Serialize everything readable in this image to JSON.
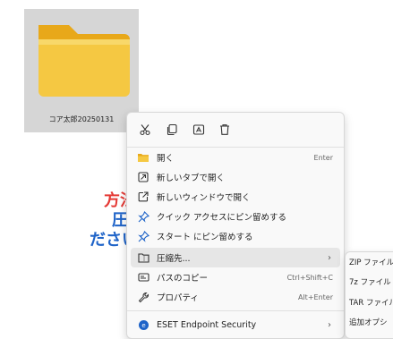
{
  "folder": {
    "name": "コア太郎20250131",
    "icon": "folder-icon"
  },
  "background_text": {
    "line1": "方法",
    "line2": "圧縮",
    "line3": "ださい"
  },
  "context_menu": {
    "top_actions": [
      {
        "icon": "cut-icon"
      },
      {
        "icon": "copy-icon"
      },
      {
        "icon": "rename-icon"
      },
      {
        "icon": "delete-icon"
      }
    ],
    "items": [
      {
        "label": "開く",
        "shortcut": "Enter",
        "icon": "folder-open-icon"
      },
      {
        "label": "新しいタブで開く",
        "shortcut": "",
        "icon": "new-tab-icon"
      },
      {
        "label": "新しいウィンドウで開く",
        "shortcut": "",
        "icon": "new-window-icon"
      },
      {
        "label": "クイック アクセスにピン留めする",
        "shortcut": "",
        "icon": "pin-icon"
      },
      {
        "label": "スタート にピン留めする",
        "shortcut": "",
        "icon": "pin-icon"
      },
      {
        "label": "圧縮先...",
        "shortcut": "",
        "icon": "compress-icon"
      },
      {
        "label": "パスのコピー",
        "shortcut": "Ctrl+Shift+C",
        "icon": "copy-path-icon"
      },
      {
        "label": "プロパティ",
        "shortcut": "Alt+Enter",
        "icon": "properties-icon"
      },
      {
        "label": "ESET Endpoint Security",
        "shortcut": "",
        "icon": "eset-icon"
      }
    ]
  },
  "submenu": {
    "items": [
      {
        "label": "ZIP ファイル"
      },
      {
        "label": "7z ファイル"
      },
      {
        "label": "TAR ファイル"
      },
      {
        "label": "追加オプシ"
      }
    ]
  },
  "colors": {
    "folder_yellow": "#f5c842",
    "folder_tab": "#e8a81a",
    "accent_red": "#e53935",
    "accent_blue": "#1e63c8",
    "menu_bg": "#f9f9f9"
  }
}
